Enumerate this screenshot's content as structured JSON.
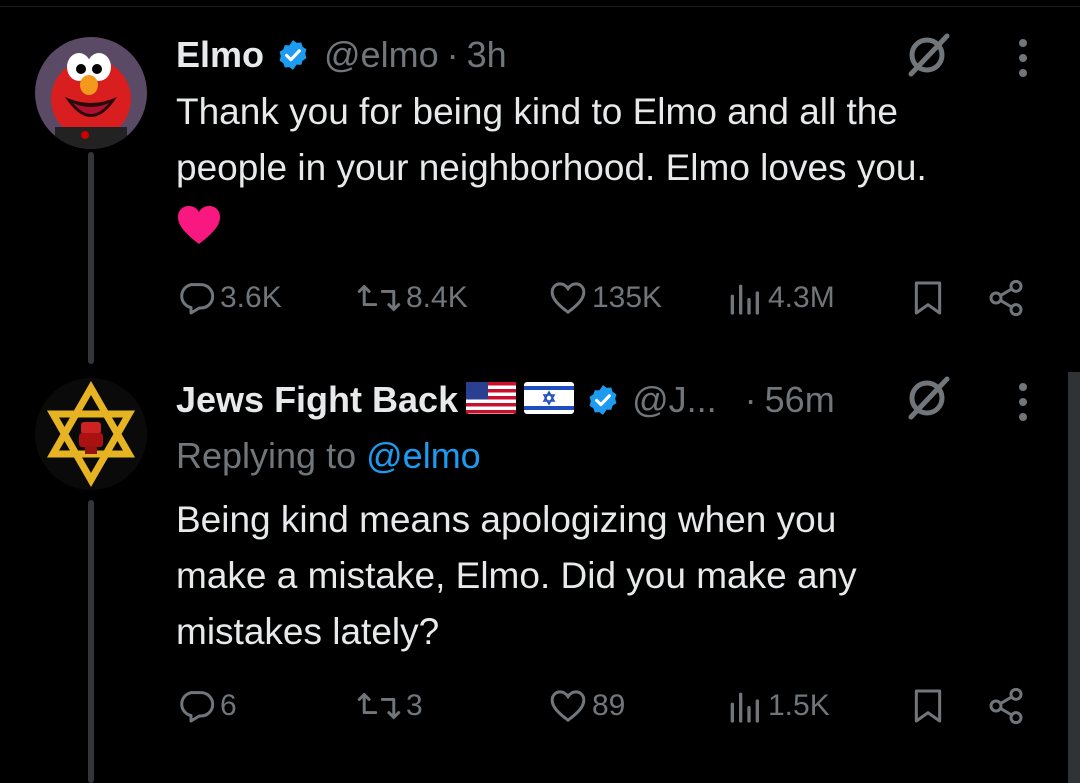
{
  "tweets": [
    {
      "author": "Elmo",
      "handle": "@elmo",
      "sep": "·",
      "time": "3h",
      "verified": true,
      "avatar_icon": "elmo-avatar",
      "text_lines": [
        "Thank you for being kind to Elmo and all the",
        "people in your neighborhood. Elmo loves you."
      ],
      "emoji": "heart-emoji",
      "replies": "3.6K",
      "reposts": "8.4K",
      "likes": "135K",
      "views": "4.3M"
    },
    {
      "author": "Jews Fight Back",
      "handle": "@J...",
      "sep": "·",
      "time": "56m",
      "verified": true,
      "avatar_icon": "star-of-david-fist-avatar",
      "reply_prefix": "Replying to",
      "reply_target": "@elmo",
      "text_lines": [
        "Being kind means apologizing when you",
        "make a mistake, Elmo. Did you make any",
        "mistakes lately?"
      ],
      "replies": "6",
      "reposts": "3",
      "likes": "89",
      "views": "1.5K"
    }
  ],
  "colors": {
    "background": "#000000",
    "text": "#e7e9ea",
    "muted": "#71767b",
    "link": "#1d9bf0",
    "verified": "#1d9bf0",
    "heart": "#f91880"
  }
}
